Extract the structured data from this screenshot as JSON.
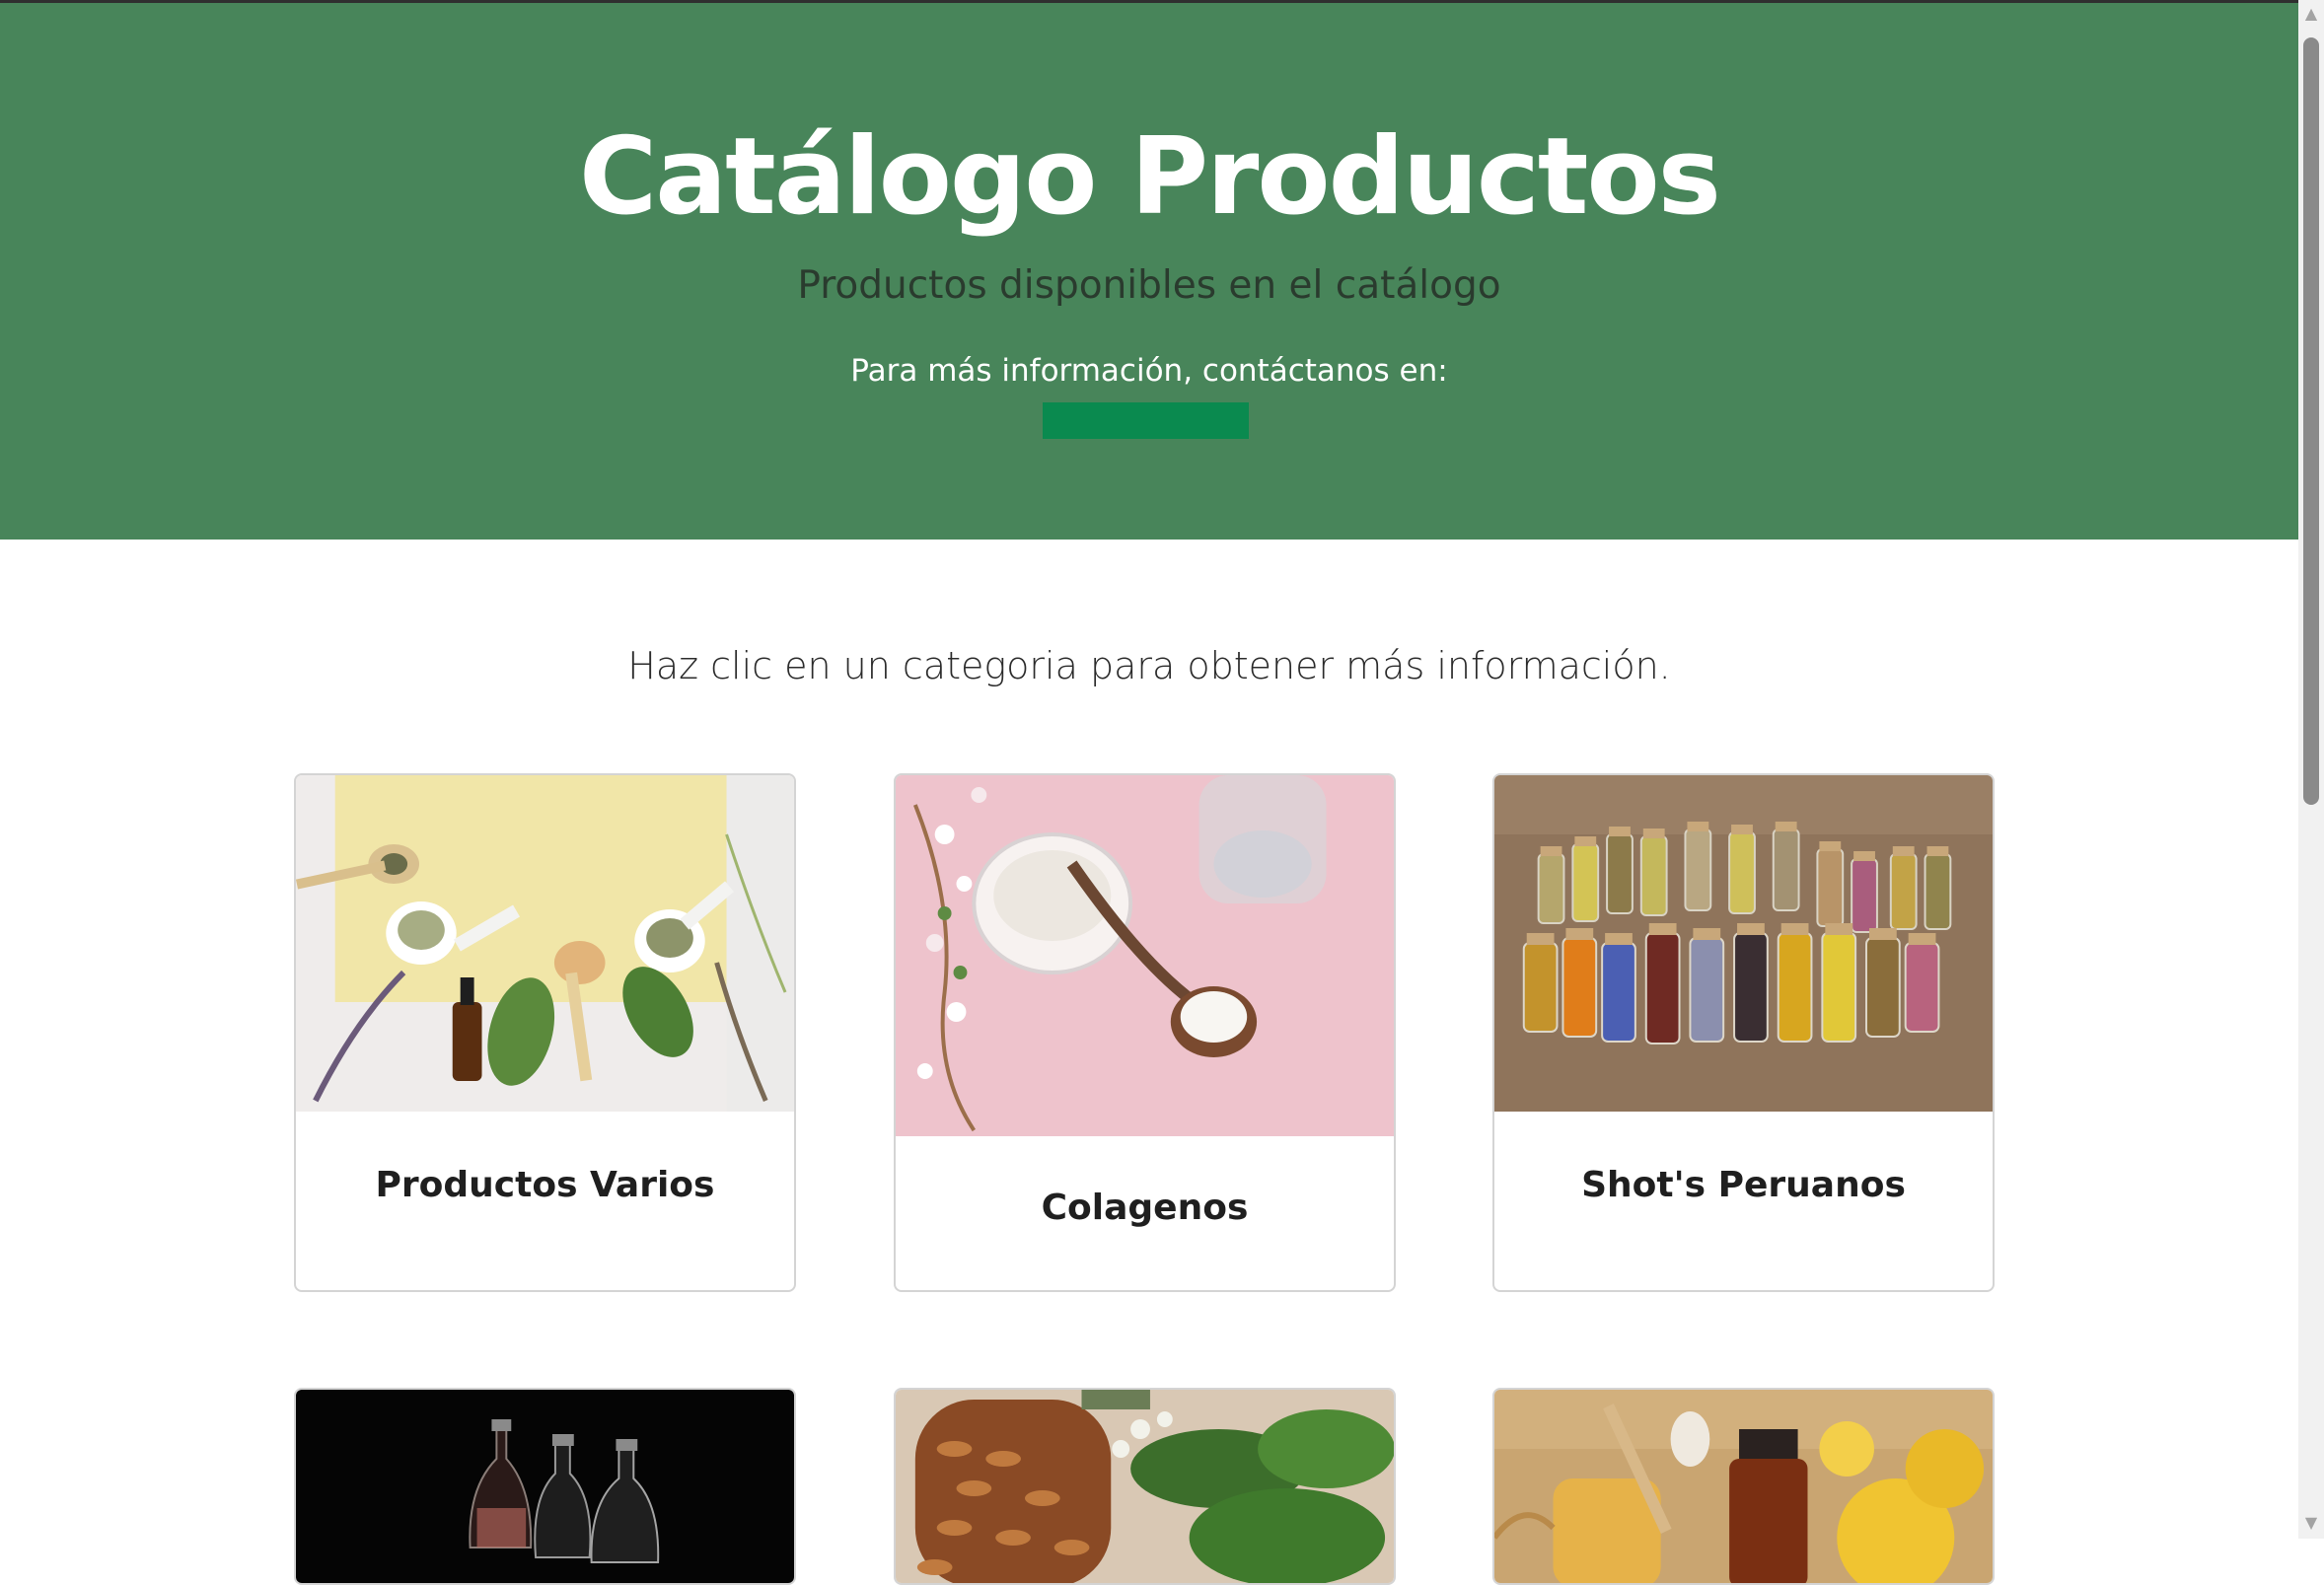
{
  "hero": {
    "title": "Catálogo Productos",
    "subtitle": "Productos disponibles en el catálogo",
    "contact_text": "Para más información, contáctanos en:",
    "contact_button_color": "#0a8a4f",
    "background_color": "#48855a"
  },
  "instructions": "Haz clic en un categoria para obtener más información.",
  "categories": [
    {
      "title": "Productos Varios",
      "image": "herbs-mortar-oil-image"
    },
    {
      "title": "Colagenos",
      "image": "collagen-powder-spoon-image"
    },
    {
      "title": "Shot's Peruanos",
      "image": "herbal-jars-image"
    },
    {
      "title": "",
      "image": "glass-flasks-dark-image"
    },
    {
      "title": "",
      "image": "capsules-herbs-image"
    },
    {
      "title": "",
      "image": "honey-lemon-bottle-image"
    }
  ]
}
